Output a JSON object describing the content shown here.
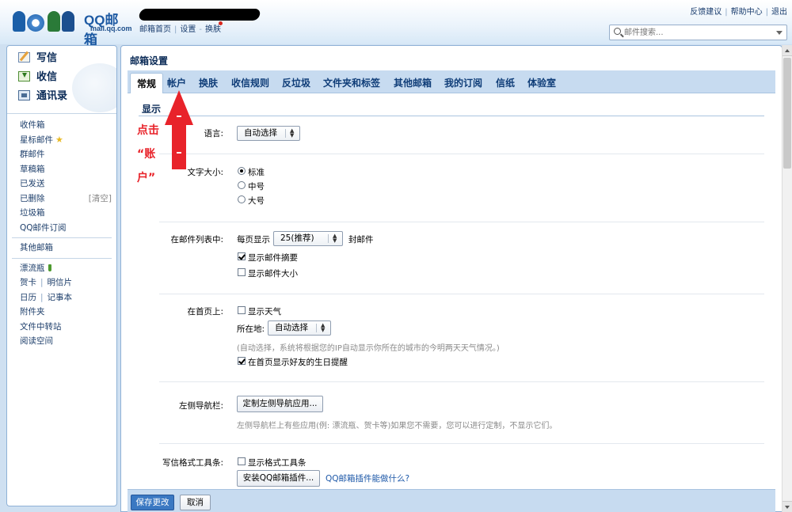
{
  "logo": {
    "title": "QQ邮箱",
    "domain": "mail.qq.com"
  },
  "header": {
    "links": [
      "邮箱首页",
      "设置",
      "换肤"
    ],
    "right_links": [
      "反馈建议",
      "帮助中心",
      "退出"
    ],
    "search_placeholder": "邮件搜索..."
  },
  "sidebar": {
    "quick": [
      {
        "label": "写信",
        "icon": "write-icon"
      },
      {
        "label": "收信",
        "icon": "inbox-icon"
      },
      {
        "label": "通讯录",
        "icon": "contacts-icon"
      }
    ],
    "folders": [
      "收件箱",
      "星标邮件",
      "群邮件",
      "草稿箱",
      "已发送",
      "已删除",
      "垃圾箱",
      "QQ邮件订阅"
    ],
    "clear_label": "[清空]",
    "other_mail": "其他邮箱",
    "apps": {
      "drift_bottle": "漂流瓶",
      "card": "贺卡",
      "postcard": "明信片",
      "calendar": "日历",
      "notes": "记事本",
      "attachments": "附件夹",
      "transfer": "文件中转站",
      "reading": "阅读空间"
    }
  },
  "main": {
    "title": "邮箱设置",
    "tabs": [
      "常规",
      "帐户",
      "换肤",
      "收信规则",
      "反垃圾",
      "文件夹和标签",
      "其他邮箱",
      "我的订阅",
      "信纸",
      "体验室"
    ],
    "section_title": "显示",
    "language": {
      "label": "语言:",
      "value": "自动选择"
    },
    "font_size": {
      "label": "文字大小:",
      "options": [
        "标准",
        "中号",
        "大号"
      ],
      "selected": "标准"
    },
    "mail_list": {
      "label": "在邮件列表中:",
      "per_page_prefix": "每页显示",
      "per_page_value": "25(推荐)",
      "per_page_suffix": "封邮件",
      "show_summary": "显示邮件摘要",
      "show_size": "显示邮件大小"
    },
    "homepage": {
      "label": "在首页上:",
      "show_weather": "显示天气",
      "location_label": "所在地:",
      "location_value": "自动选择",
      "hint": "(自动选择，系统将根据您的IP自动显示你所在的城市的今明两天天气情况。)",
      "birthday": "在首页显示好友的生日提醒"
    },
    "left_nav": {
      "label": "左侧导航栏:",
      "button": "定制左侧导航应用...",
      "hint": "左侧导航栏上有些应用(例: 漂流瓶、贺卡等)如果您不需要，您可以进行定制，不显示它们。"
    },
    "toolbar": {
      "label": "写信格式工具条:",
      "show_toolbar": "显示格式工具条",
      "install_button": "安装QQ邮箱插件...",
      "plugin_link": "QQ邮箱插件能做什么?"
    },
    "save_label": "保存更改",
    "cancel_label": "取消"
  },
  "annotation": {
    "lines": [
      "点击",
      "“账",
      "户”"
    ],
    "color": "#e8232a"
  }
}
